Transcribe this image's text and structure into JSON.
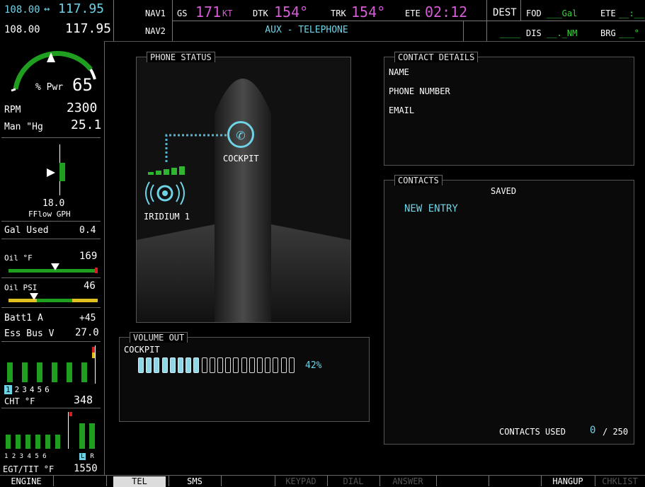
{
  "top_bar": {
    "com1_active": "108.00",
    "com1_swap_icon": "swap-arrow-icon",
    "com1_standby": "117.95",
    "com2_active": "108.00",
    "com2_standby": "117.95",
    "nav1_label": "NAV1",
    "nav2_label": "NAV2",
    "gs_label": "GS",
    "gs_value": "171",
    "gs_unit": "KT",
    "dtk_label": "DTK",
    "dtk_value": "154°",
    "trk_label": "TRK",
    "trk_value": "154°",
    "ete_label": "ETE",
    "ete_value": "02:12",
    "page_title": "AUX - TELEPHONE",
    "dest_label": "DEST",
    "fod_label": "FOD",
    "fod_value": "___Gal",
    "ete2_label": "ETE",
    "ete2_value": "__:__",
    "dest_value": "____",
    "dis_label": "DIS",
    "dis_value": "__._NM",
    "brg_label": "BRG",
    "brg_value": "___°"
  },
  "engine": {
    "pwr_label": "% Pwr",
    "pwr_value": "65",
    "rpm_label": "RPM",
    "rpm_value": "2300",
    "man_label": "Man \"Hg",
    "man_value": "25.1",
    "fflow_value": "18.0",
    "fflow_label": "FFlow GPH",
    "gal_used_label": "Gal Used",
    "gal_used_value": "0.4",
    "oil_f_label": "Oil °F",
    "oil_f_value": "169",
    "oil_psi_label": "Oil PSI",
    "oil_psi_value": "46",
    "batt_label": "Batt1 A",
    "batt_value": "+45",
    "essbus_label": "Ess Bus V",
    "essbus_value": "27.0",
    "cht_cylinders": [
      "1",
      "2",
      "3",
      "4",
      "5",
      "6"
    ],
    "cht_label": "CHT °F",
    "cht_value": "348",
    "egt_cylinders": "1 2 3 4 5 6",
    "egt_lr": [
      "L",
      "R"
    ],
    "egt_label": "EGT/TIT °F",
    "egt_value": "1550"
  },
  "phone_status": {
    "title": "PHONE STATUS",
    "cockpit_label": "COCKPIT",
    "iridium_label": "IRIDIUM 1"
  },
  "volume_out": {
    "title": "VOLUME OUT",
    "channel": "COCKPIT",
    "percent_text": "42%",
    "level": 0.42,
    "segments_total": 20
  },
  "contact_details": {
    "title": "CONTACT DETAILS",
    "name_label": "NAME",
    "phone_label": "PHONE NUMBER",
    "email_label": "EMAIL"
  },
  "contacts": {
    "title": "CONTACTS",
    "column": "SAVED",
    "new_entry": "NEW ENTRY",
    "used_label": "CONTACTS USED",
    "used_value": "0",
    "used_max": "/ 250"
  },
  "softkeys": {
    "engine": "ENGINE",
    "tel": "TEL",
    "sms": "SMS",
    "keypad": "KEYPAD",
    "dial": "DIAL",
    "answer": "ANSWER",
    "hangup": "HANGUP",
    "chklist": "CHKLIST"
  },
  "colors": {
    "magenta": "#d45cd4",
    "cyan": "#6fd3e6",
    "green": "#1f9e1f"
  }
}
